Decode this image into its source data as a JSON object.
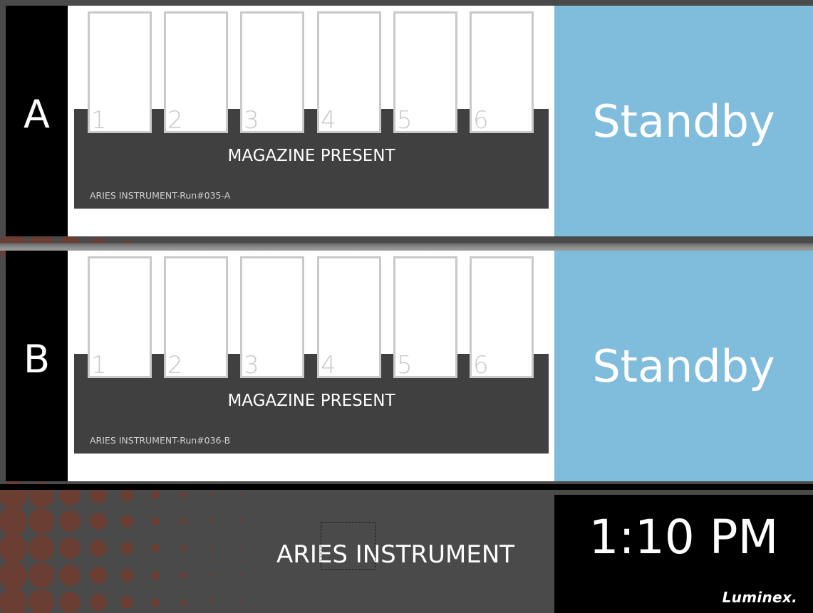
{
  "bays": [
    {
      "letter": "A",
      "slots": [
        "1",
        "2",
        "3",
        "4",
        "5",
        "6"
      ],
      "magazine_status": "MAGAZINE PRESENT",
      "run_name": "ARIES INSTRUMENT-Run#035-A",
      "state": "Standby"
    },
    {
      "letter": "B",
      "slots": [
        "1",
        "2",
        "3",
        "4",
        "5",
        "6"
      ],
      "magazine_status": "MAGAZINE PRESENT",
      "run_name": "ARIES INSTRUMENT-Run#036-B",
      "state": "Standby"
    }
  ],
  "footer": {
    "instrument_name": "ARIES INSTRUMENT",
    "time": "1:10 PM",
    "logo_text": "Luminex."
  },
  "colors": {
    "status_standby": "#80bcdb",
    "magazine": "#404040",
    "slot_border": "#c9c9c9",
    "dot": "#6a3e33"
  },
  "icons": [
    "dot-pattern-graphic"
  ]
}
